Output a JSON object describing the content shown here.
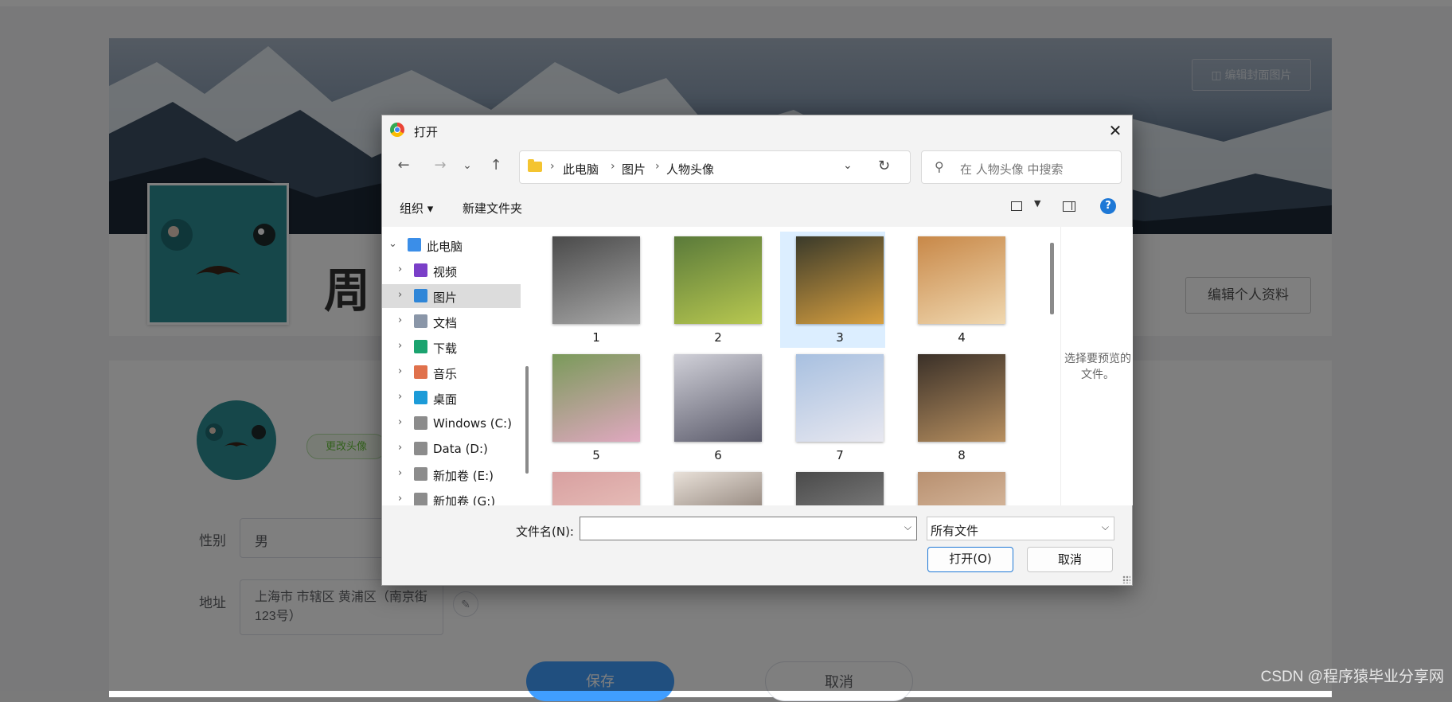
{
  "background": {
    "edit_cover_label": "编辑封面图片",
    "username": "周",
    "edit_profile_label": "编辑个人资料",
    "change_avatar_label": "更改头像",
    "gender_label": "性别",
    "gender_value": "男",
    "address_label": "地址",
    "address_value": "上海市 市辖区 黄浦区（南京街123号）",
    "save_label": "保存",
    "cancel_label": "取消",
    "watermark": "CSDN @程序猿毕业分享网"
  },
  "dialog": {
    "title": "打开",
    "close_glyph": "✕",
    "nav": {
      "back": "←",
      "forward": "→",
      "recent": "⌄",
      "up": "↑"
    },
    "breadcrumb": [
      "此电脑",
      "图片",
      "人物头像"
    ],
    "search_placeholder": "在 人物头像 中搜索",
    "toolbar": {
      "organize": "组织 ▾",
      "new_folder": "新建文件夹",
      "help": "?"
    },
    "tree": [
      {
        "label": "此电脑",
        "icon": "pc-icon",
        "color": "#3b8ee8",
        "expanded": true
      },
      {
        "label": "视频",
        "icon": "video-icon",
        "color": "#7a3fc8"
      },
      {
        "label": "图片",
        "icon": "pictures-icon",
        "color": "#2f86d8",
        "selected": true
      },
      {
        "label": "文档",
        "icon": "documents-icon",
        "color": "#8a96a8"
      },
      {
        "label": "下载",
        "icon": "download-icon",
        "color": "#1ba36f"
      },
      {
        "label": "音乐",
        "icon": "music-icon",
        "color": "#e0714c"
      },
      {
        "label": "桌面",
        "icon": "desktop-icon",
        "color": "#1c9bd8"
      },
      {
        "label": "Windows (C:)",
        "icon": "drive-icon",
        "color": "#8c8c8c"
      },
      {
        "label": "Data (D:)",
        "icon": "drive-icon",
        "color": "#8c8c8c"
      },
      {
        "label": "新加卷 (E:)",
        "icon": "drive-icon",
        "color": "#8c8c8c"
      },
      {
        "label": "新加卷 (G:)",
        "icon": "drive-icon",
        "color": "#8c8c8c"
      }
    ],
    "files": [
      {
        "name": "1",
        "colors": [
          "#4a4a4a",
          "#a8a8a8"
        ]
      },
      {
        "name": "2",
        "colors": [
          "#5a7a3a",
          "#b8c850"
        ]
      },
      {
        "name": "3",
        "colors": [
          "#3a3a2a",
          "#d8a040"
        ],
        "hover": true
      },
      {
        "name": "4",
        "colors": [
          "#c88848",
          "#f0d8b0"
        ]
      },
      {
        "name": "5",
        "colors": [
          "#7a9a5a",
          "#e0a8c0"
        ]
      },
      {
        "name": "6",
        "colors": [
          "#d0d0d8",
          "#5a5a6a"
        ]
      },
      {
        "name": "7",
        "colors": [
          "#a8c0e0",
          "#e8e8f0"
        ]
      },
      {
        "name": "8",
        "colors": [
          "#3a3028",
          "#b89060"
        ]
      },
      {
        "name": "",
        "colors": [
          "#d8a0a0",
          "#f0d0c8"
        ]
      },
      {
        "name": "",
        "colors": [
          "#e8e0d8",
          "#5a4a40"
        ]
      },
      {
        "name": "",
        "colors": [
          "#4a4a4a",
          "#9a9a9a"
        ]
      },
      {
        "name": "",
        "colors": [
          "#b89070",
          "#e8d0b8"
        ]
      }
    ],
    "preview_text": "选择要预览的文件。",
    "filename_label": "文件名(N):",
    "filename_value": "",
    "filetype_value": "所有文件",
    "open_label": "打开(O)",
    "cancel_label": "取消",
    "chevron_right": "›",
    "chevron_down": "⌄",
    "dropdown_glyph": "⌵",
    "refresh_glyph": "↻",
    "search_glyph": "⚲"
  }
}
